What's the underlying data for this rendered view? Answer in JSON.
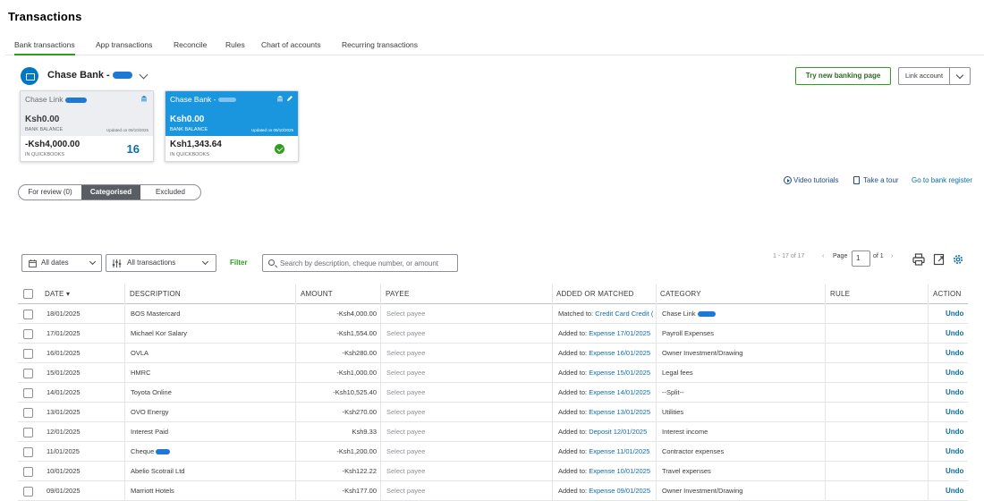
{
  "page": {
    "title": "Transactions"
  },
  "tabs": [
    {
      "label": "Bank transactions"
    },
    {
      "label": "App transactions"
    },
    {
      "label": "Reconcile"
    },
    {
      "label": "Rules"
    },
    {
      "label": "Chart of accounts"
    },
    {
      "label": "Recurring transactions"
    }
  ],
  "account": {
    "name": "Chase Bank -",
    "try_new_label": "Try new banking page",
    "link_account_label": "Link account"
  },
  "cards": [
    {
      "name": "Chase Link",
      "balance": "Ksh0.00",
      "balance_label": "BANK BALANCE",
      "updated": "Updated on 09/10/2025",
      "qb_balance": "-Ksh4,000.00",
      "qb_label": "IN QUICKBOOKS",
      "count": "16"
    },
    {
      "name": "Chase Bank - ",
      "balance": "Ksh0.00",
      "balance_label": "BANK BALANCE",
      "updated": "Updated on 09/10/2025",
      "qb_balance": "Ksh1,343.64",
      "qb_label": "IN QUICKBOOKS"
    }
  ],
  "view_tabs": [
    {
      "label": "For review (0)"
    },
    {
      "label": "Categorised"
    },
    {
      "label": "Excluded"
    }
  ],
  "help": {
    "video": "Video tutorials",
    "tour": "Take a tour",
    "register": "Go to bank register"
  },
  "filters": {
    "dates": "All dates",
    "transactions": "All transactions",
    "filter_label": "Filter",
    "search_placeholder": "Search by description, cheque number, or amount"
  },
  "pagination": {
    "range": "1 - 17 of 17",
    "page_label": "Page",
    "page": "1",
    "of": "of 1"
  },
  "table": {
    "headers": {
      "date": "DATE ▾",
      "description": "DESCRIPTION",
      "amount": "AMOUNT",
      "payee": "PAYEE",
      "added": "ADDED OR MATCHED",
      "category": "CATEGORY",
      "rule": "RULE",
      "action": "ACTION"
    },
    "rows": [
      {
        "date": "18/01/2025",
        "description": "BOS Mastercard",
        "amount": "-Ksh4,000.00",
        "payee": "Select payee",
        "added_prefix": "Matched to:",
        "added_link": "Credit Card Credit (",
        "category": "Chase Link",
        "action": "Undo"
      },
      {
        "date": "17/01/2025",
        "description": "Michael Kor Salary",
        "amount": "-Ksh1,554.00",
        "payee": "Select payee",
        "added_prefix": "Added to:",
        "added_link": "Expense 17/01/2025",
        "category": "Payroll Expenses",
        "action": "Undo"
      },
      {
        "date": "16/01/2025",
        "description": "OVLA",
        "amount": "-Ksh280.00",
        "payee": "Select payee",
        "added_prefix": "Added to:",
        "added_link": "Expense 16/01/2025",
        "category": "Owner Investment/Drawing",
        "action": "Undo"
      },
      {
        "date": "15/01/2025",
        "description": "HMRC",
        "amount": "-Ksh1,000.00",
        "payee": "Select payee",
        "added_prefix": "Added to:",
        "added_link": "Expense 15/01/2025",
        "category": "Legal fees",
        "action": "Undo"
      },
      {
        "date": "14/01/2025",
        "description": "Toyota Online",
        "amount": "-Ksh10,525.40",
        "payee": "Select payee",
        "added_prefix": "Added to:",
        "added_link": "Expense 14/01/2025",
        "category": "--Split--",
        "action": "Undo"
      },
      {
        "date": "13/01/2025",
        "description": "OVO Energy",
        "amount": "-Ksh270.00",
        "payee": "Select payee",
        "added_prefix": "Added to:",
        "added_link": "Expense 13/01/2025",
        "category": "Utilities",
        "action": "Undo"
      },
      {
        "date": "12/01/2025",
        "description": "Interest Paid",
        "amount": "Ksh9.33",
        "payee": "Select payee",
        "added_prefix": "Added to:",
        "added_link": "Deposit 12/01/2025",
        "category": "Interest income",
        "action": "Undo"
      },
      {
        "date": "11/01/2025",
        "description": "Cheque",
        "amount": "-Ksh1,200.00",
        "payee": "Select payee",
        "added_prefix": "Added to:",
        "added_link": "Expense 11/01/2025",
        "category": "Contractor expenses",
        "action": "Undo"
      },
      {
        "date": "10/01/2025",
        "description": "Abelio Scotrail Ltd",
        "amount": "-Ksh122.22",
        "payee": "Select payee",
        "added_prefix": "Added to:",
        "added_link": "Expense 10/01/2025",
        "category": "Travel expenses",
        "action": "Undo"
      },
      {
        "date": "09/01/2025",
        "description": "Marriott Hotels",
        "amount": "-Ksh177.00",
        "payee": "Select payee",
        "added_prefix": "Added to:",
        "added_link": "Expense 09/01/2025",
        "category": "Owner Investment/Drawing",
        "action": "Undo"
      }
    ]
  },
  "colors": {
    "accent_green": "#2ca01c",
    "link_blue": "#0b6ea8",
    "card_blue": "#1a96df",
    "redaction_blue": "#1e78d7"
  }
}
